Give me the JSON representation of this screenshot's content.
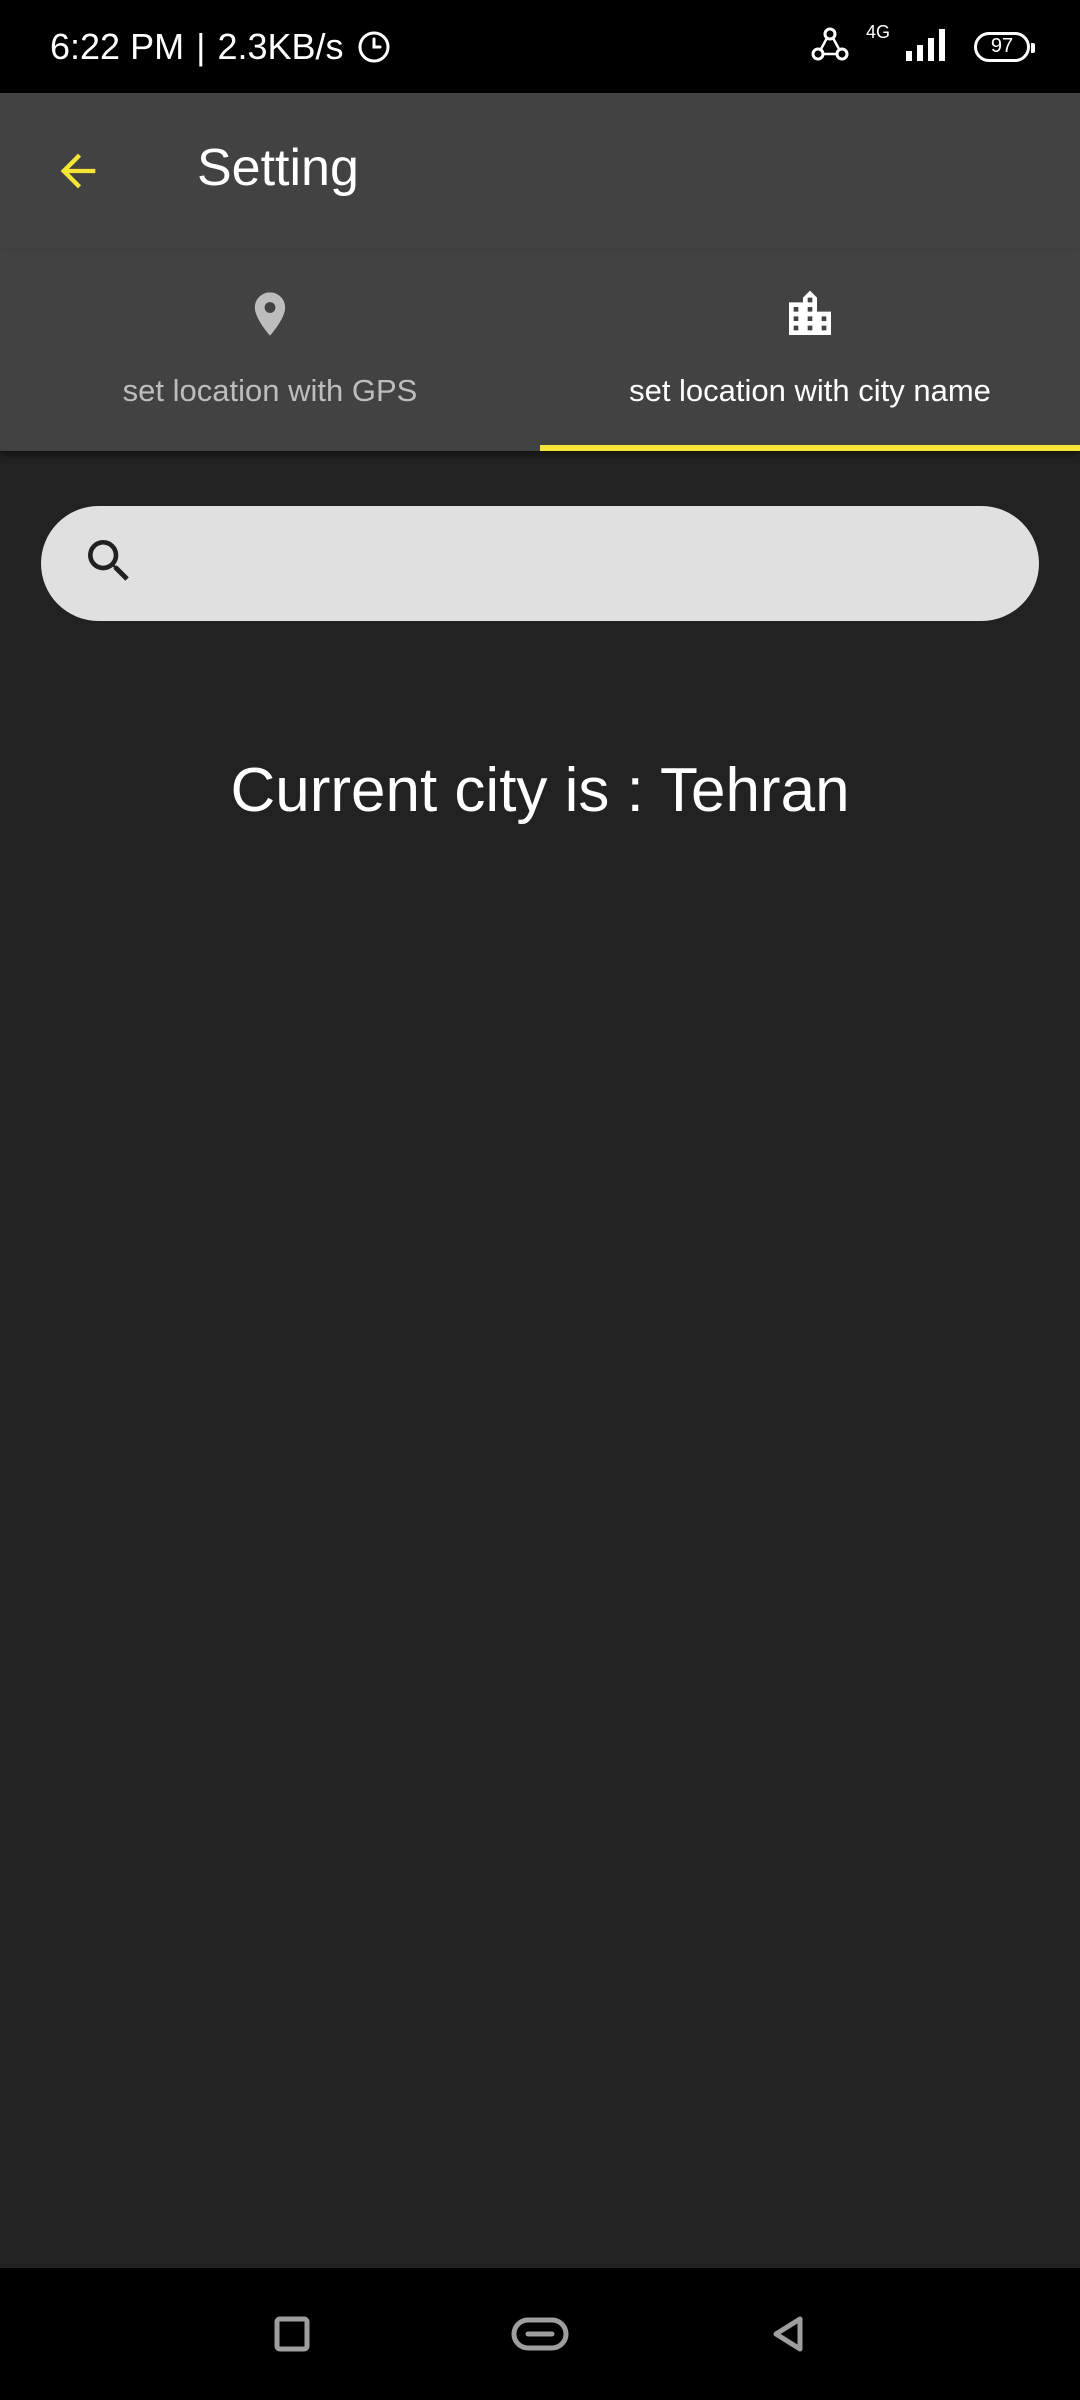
{
  "status_bar": {
    "time": "6:22 PM",
    "separator": "|",
    "net_speed": "2.3KB/s",
    "network_type": "4G",
    "battery": "97"
  },
  "app_bar": {
    "title": "Setting",
    "back_icon": "arrow-back-icon"
  },
  "tabs": [
    {
      "label": "set location with GPS",
      "icon": "location-pin-icon",
      "active": false
    },
    {
      "label": "set location with city name",
      "icon": "city-building-icon",
      "active": true
    }
  ],
  "search": {
    "placeholder": "",
    "value": "",
    "icon": "search-icon"
  },
  "current_city_text": "Current city is : Tehran",
  "nav_bar": {
    "items": [
      "recent-apps-icon",
      "home-icon",
      "back-icon"
    ]
  },
  "colors": {
    "accent": "#f5e636",
    "app_bar": "#424242",
    "background": "#222222",
    "search_bg": "#e0e0e0"
  }
}
